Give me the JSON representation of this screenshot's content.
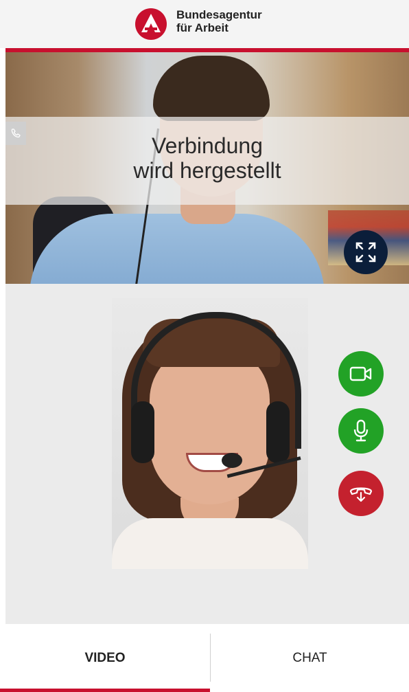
{
  "header": {
    "brand_line1": "Bundesagentur",
    "brand_line2": "für Arbeit",
    "logo_icon": "ba-logo-icon",
    "accent_color": "#c8102e"
  },
  "remote_video": {
    "status_line1": "Verbindung",
    "status_line2": "wird hergestellt",
    "phone_icon": "phone-icon",
    "fullscreen_icon": "expand-icon"
  },
  "controls": [
    {
      "name": "camera",
      "icon": "video-camera-icon",
      "color": "#22a226"
    },
    {
      "name": "microphone",
      "icon": "microphone-icon",
      "color": "#22a226"
    },
    {
      "name": "hang-up",
      "icon": "hang-up-icon",
      "color": "#c4212e"
    }
  ],
  "tabs": {
    "video_label": "VIDEO",
    "chat_label": "CHAT",
    "active": "VIDEO"
  }
}
